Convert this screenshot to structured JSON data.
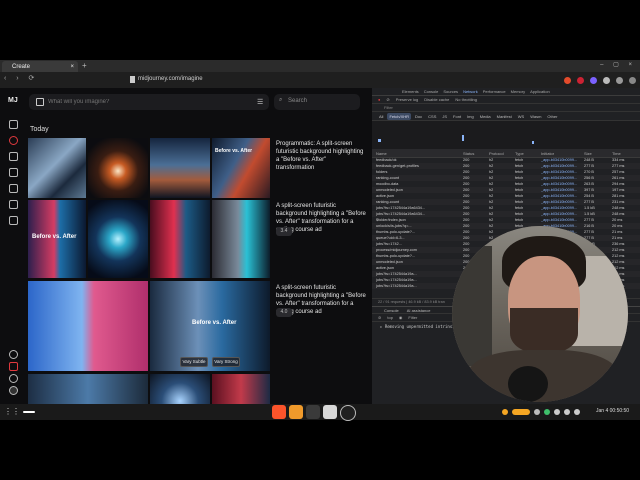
{
  "browser": {
    "tab_title": "Create",
    "tab_close": "×",
    "new_tab": "+",
    "window_controls": "–  ▢  ×",
    "nav": "‹  ›  ⟳",
    "url": "midjourney.com/imagine"
  },
  "mj": {
    "logo": "MJ",
    "prompt_placeholder": "What will you imagine?",
    "search_placeholder": "Search",
    "section": "Today",
    "overlay_before_after": "Before vs. After",
    "overlay_before_after_short": "Before vs. After",
    "vary_subtle": "Vary Subtle",
    "vary_strong": "Vary Strong",
    "groups": [
      {
        "desc": "Programmatic: A split-screen futuristic background highlighting a \"Before vs. After\" transformation",
        "badge": ""
      },
      {
        "desc": "A split-screen futuristic background highlighting a \"Before vs. After\" transformation for a coding course ad",
        "badge": "3.4"
      },
      {
        "desc": "A split-screen futuristic background highlighting a \"Before vs. After\" transformation for a coding course ad",
        "badge": "4.0"
      }
    ]
  },
  "devtools": {
    "tabs": [
      "Elements",
      "Console",
      "Sources",
      "Network",
      "Performance",
      "Memory",
      "Application"
    ],
    "active_tab": "Network",
    "toolbar": [
      "Preserve log",
      "Disable cache",
      "No throttling"
    ],
    "filter_placeholder": "Filter",
    "type_filters": [
      "All",
      "Fetch/XHR",
      "Doc",
      "CSS",
      "JS",
      "Font",
      "Img",
      "Media",
      "Manifest",
      "WS",
      "Wasm",
      "Other"
    ],
    "active_type": "Fetch/XHR",
    "columns": [
      "Name",
      "Status",
      "Protocol",
      "Type",
      "Initiator",
      "Size",
      "Time"
    ],
    "rows": [
      {
        "name": "feedback/ok",
        "status": "200",
        "protocol": "h2",
        "type": "fetch",
        "initiator": "_app-b03410b0099...",
        "size": "248 B",
        "time": "334 ms"
      },
      {
        "name": "feedback-gen/get-profiles",
        "status": "200",
        "protocol": "h2",
        "type": "fetch",
        "initiator": "_app-b03410b0099...",
        "size": "277 B",
        "time": "277 ms"
      },
      {
        "name": "folders",
        "status": "200",
        "protocol": "h2",
        "type": "fetch",
        "initiator": "_app-b03410b0099...",
        "size": "270 B",
        "time": "257 ms"
      },
      {
        "name": "ranking-count",
        "status": "200",
        "protocol": "h2",
        "type": "fetch",
        "initiator": "_app-b03410b0099...",
        "size": "256 B",
        "time": "261 ms"
      },
      {
        "name": "moodbo-data",
        "status": "200",
        "protocol": "h2",
        "type": "fetch",
        "initiator": "_app-b03410b0099...",
        "size": "263 B",
        "time": "294 ms"
      },
      {
        "name": "unmodeled.json",
        "status": "200",
        "protocol": "h2",
        "type": "fetch",
        "initiator": "_app-b03410b0099...",
        "size": "397 B",
        "time": "197 ms"
      },
      {
        "name": "active.json",
        "status": "200",
        "protocol": "h2",
        "type": "fetch",
        "initiator": "_app-b03410b0099...",
        "size": "254 B",
        "time": "281 ms"
      },
      {
        "name": "ranking-count",
        "status": "200",
        "protocol": "h2",
        "type": "fetch",
        "initiator": "_app-b03410b0099...",
        "size": "277 B",
        "time": "231 ms"
      },
      {
        "name": "jobs?ts=1742544a19a6434...",
        "status": "200",
        "protocol": "h2",
        "type": "fetch",
        "initiator": "_app-b03410b0099...",
        "size": "1.5 kB",
        "time": "248 ms"
      },
      {
        "name": "jobs?ts=1742544a19a6434...",
        "status": "200",
        "protocol": "h2",
        "type": "fetch",
        "initiator": "_app-b03410b0099...",
        "size": "1.5 kB",
        "time": "248 ms"
      },
      {
        "name": "$folder/index.json",
        "status": "200",
        "protocol": "h2",
        "type": "fetch",
        "initiator": "_app-b03410b0099...",
        "size": "277 B",
        "time": "20 ms"
      },
      {
        "name": "unlock/s/is-jobs?q=...",
        "status": "200",
        "protocol": "h2",
        "type": "fetch",
        "initiator": "_app-b03410b0099...",
        "size": "216 B",
        "time": "20 ms"
      },
      {
        "name": "thumbs-polo-update?...",
        "status": "200",
        "protocol": "h2",
        "type": "fetch",
        "initiator": "_app-b03410b0099...",
        "size": "277 B",
        "time": "21 ms"
      },
      {
        "name": "queue?uid=6-3...",
        "status": "200",
        "protocol": "h2",
        "type": "fetch",
        "initiator": "_app-b03410b0099...",
        "size": "277 B",
        "time": "21 ms"
      },
      {
        "name": "jobs?ts=1742...",
        "status": "200",
        "protocol": "h2",
        "type": "fetch",
        "initiator": "_app-b03410b0099...",
        "size": "1.5 kB",
        "time": "236 ms"
      },
      {
        "name": "process/midjourney.com",
        "status": "200",
        "protocol": "h2",
        "type": "fetch",
        "initiator": "_app-b03410b0099...",
        "size": "277 B",
        "time": "212 ms"
      },
      {
        "name": "thumbs-polo-update?...",
        "status": "200",
        "protocol": "h2",
        "type": "fetch",
        "initiator": "_app-b03410b0099...",
        "size": "277 B",
        "time": "212 ms"
      },
      {
        "name": "unmodeled.json",
        "status": "200",
        "protocol": "h2",
        "type": "fetch",
        "initiator": "_app-b03410b0099...",
        "size": "277 B",
        "time": "212 ms"
      },
      {
        "name": "active.json",
        "status": "200",
        "protocol": "h2",
        "type": "fetch",
        "initiator": "_app-b03410b0099...",
        "size": "277 B",
        "time": "212 ms"
      },
      {
        "name": "jobs?ts=1742544a19a...",
        "status": "200",
        "protocol": "h2",
        "type": "fetch",
        "initiator": "_app-b03410b0099...",
        "size": "1.5 kB",
        "time": "212 ms"
      },
      {
        "name": "jobs?ts=1742544a19a...",
        "status": "200",
        "protocol": "h2",
        "type": "fetch",
        "initiator": "_app-b03410b0099...",
        "size": "1.5 kB",
        "time": "212 ms"
      },
      {
        "name": "jobs?ts=1742544a19a...",
        "status": "200",
        "protocol": "h2",
        "type": "fetch",
        "initiator": "_app-b03410b0099...",
        "size": "1.5 kB",
        "time": "212 ms"
      }
    ],
    "status_line": "22 / 91 requests  |  46.9 kB / 83.9 kB tran",
    "console_tabs": [
      "Console",
      "AI assistance"
    ],
    "console_toolbar": [
      "top",
      "Filter"
    ],
    "console_message": "▸ Removing unpermitted intrinsics"
  },
  "taskbar": {
    "apps_icon": "⋮⋮",
    "clock": "Jan 4   00:50:50"
  },
  "colors": {
    "accent": "#8ab4f8",
    "orange": "#f5a623",
    "red": "#e0393e"
  }
}
